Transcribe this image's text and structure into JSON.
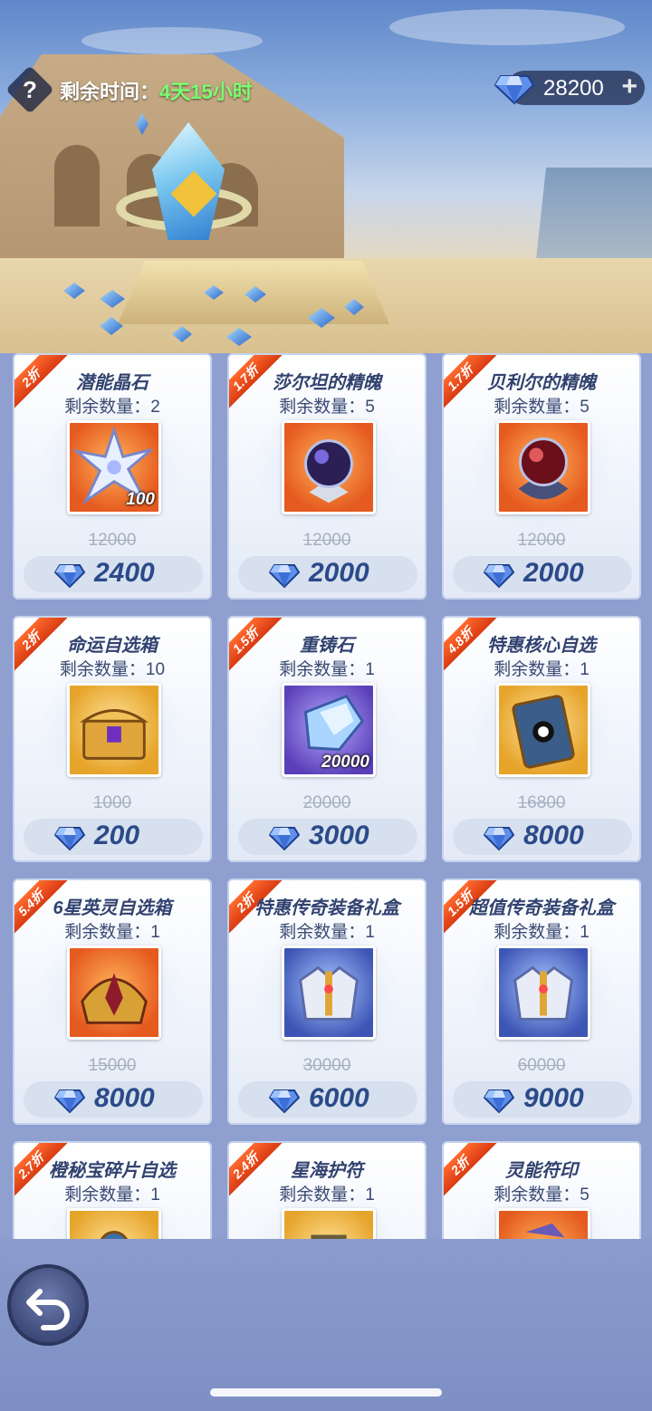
{
  "header": {
    "help_icon": "question-icon",
    "timer_label": "剩余时间：",
    "timer_value": "4天15小时",
    "currency_value": "28200",
    "currency_add": "+",
    "currency_icon": "diamond-icon"
  },
  "items": [
    {
      "discount": "2折",
      "name": "潜能晶石",
      "left": "剩余数量：2",
      "old_price": "12000",
      "price": "2400",
      "qty": "100",
      "art": "star-crystal"
    },
    {
      "discount": "1.7折",
      "name": "莎尔坦的精魄",
      "left": "剩余数量：5",
      "old_price": "12000",
      "price": "2000",
      "qty": "",
      "art": "dark-orb"
    },
    {
      "discount": "1.7折",
      "name": "贝利尔的精魄",
      "left": "剩余数量：5",
      "old_price": "12000",
      "price": "2000",
      "qty": "",
      "art": "red-orb"
    },
    {
      "discount": "2折",
      "name": "命运自选箱",
      "left": "剩余数量：10",
      "old_price": "1000",
      "price": "200",
      "qty": "",
      "art": "chest"
    },
    {
      "discount": "1.5折",
      "name": "重铸石",
      "left": "剩余数量：1",
      "old_price": "20000",
      "price": "3000",
      "qty": "20000",
      "art": "reforge-stone"
    },
    {
      "discount": "4.8折",
      "name": "特惠核心自选",
      "left": "剩余数量：1",
      "old_price": "16800",
      "price": "8000",
      "qty": "",
      "art": "core-card"
    },
    {
      "discount": "5.4折",
      "name": "6星英灵自选箱",
      "left": "剩余数量：1",
      "old_price": "15000",
      "price": "8000",
      "qty": "",
      "art": "hero-chest"
    },
    {
      "discount": "2折",
      "name": "特惠传奇装备礼盒",
      "left": "剩余数量：1",
      "old_price": "30000",
      "price": "6000",
      "qty": "",
      "art": "armor-box"
    },
    {
      "discount": "1.5折",
      "name": "超值传奇装备礼盒",
      "left": "剩余数量：1",
      "old_price": "60000",
      "price": "9000",
      "qty": "",
      "art": "armor-box"
    },
    {
      "discount": "2.7折",
      "name": "橙秘宝碎片自选",
      "left": "剩余数量：1",
      "old_price": "",
      "price": "",
      "qty": "",
      "art": "relic"
    },
    {
      "discount": "2.4折",
      "name": "星海护符",
      "left": "剩余数量：1",
      "old_price": "",
      "price": "",
      "qty": "",
      "art": "amulet"
    },
    {
      "discount": "2折",
      "name": "灵能符印",
      "left": "剩余数量：5",
      "old_price": "",
      "price": "",
      "qty": "",
      "art": "sigil"
    }
  ],
  "footer": {
    "back_icon": "back-arrow-icon"
  },
  "colors": {
    "accent_ribbon": "#e8491b",
    "timer_green": "#7bff6f",
    "price_text": "#2b4a8a"
  }
}
